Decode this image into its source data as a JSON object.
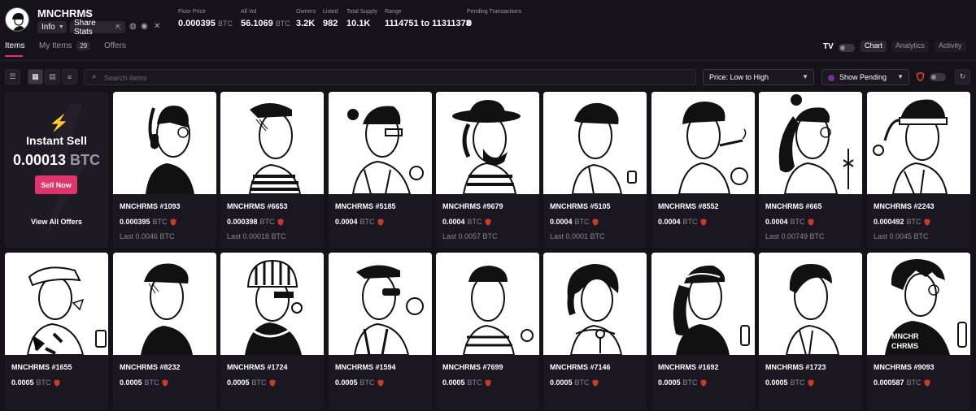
{
  "header": {
    "collection_name": "MNCHRMS",
    "info_label": "Info",
    "share_label": "Share Stats",
    "stats": [
      {
        "label": "Floor Price",
        "value": "0.000395",
        "unit": "BTC"
      },
      {
        "label": "All Vol",
        "value": "56.1069",
        "unit": "BTC"
      },
      {
        "label": "Owners",
        "value": "3.2K",
        "unit": ""
      },
      {
        "label": "Listed",
        "value": "982",
        "unit": ""
      },
      {
        "label": "Total Supply",
        "value": "10.1K",
        "unit": ""
      },
      {
        "label": "Range",
        "value": "1114751 to 11311378",
        "unit": ""
      },
      {
        "label": "Pending Transactions",
        "value": "0",
        "unit": ""
      }
    ]
  },
  "tabs": {
    "items": "Items",
    "my_items": "My Items",
    "my_items_count": "29",
    "offers": "Offers",
    "chart": "Chart",
    "analytics": "Analytics",
    "activity": "Activity"
  },
  "toolbar": {
    "search_placeholder": "Search items",
    "sort_value": "Price: Low to High",
    "pending_value": "Show Pending"
  },
  "instant_sell": {
    "title": "Instant Sell",
    "price": "0.00013",
    "unit": "BTC",
    "sell_button": "Sell Now",
    "view_offers": "View All Offers"
  },
  "cards": [
    {
      "name": "MNCHRMS #1093",
      "price": "0.000395",
      "unit": "BTC",
      "last": "Last 0.0046 BTC"
    },
    {
      "name": "MNCHRMS #6653",
      "price": "0.000398",
      "unit": "BTC",
      "last": "Last 0.00018 BTC"
    },
    {
      "name": "MNCHRMS #5185",
      "price": "0.0004",
      "unit": "BTC",
      "last": ""
    },
    {
      "name": "MNCHRMS #9679",
      "price": "0.0004",
      "unit": "BTC",
      "last": "Last 0.0057 BTC"
    },
    {
      "name": "MNCHRMS #5105",
      "price": "0.0004",
      "unit": "BTC",
      "last": "Last 0.0001 BTC"
    },
    {
      "name": "MNCHRMS #8552",
      "price": "0.0004",
      "unit": "BTC",
      "last": ""
    },
    {
      "name": "MNCHRMS #665",
      "price": "0.0004",
      "unit": "BTC",
      "last": "Last 0.00749 BTC"
    },
    {
      "name": "MNCHRMS #2243",
      "price": "0.000492",
      "unit": "BTC",
      "last": "Last 0.0045 BTC"
    },
    {
      "name": "MNCHRMS #1655",
      "price": "0.0005",
      "unit": "BTC",
      "last": ""
    },
    {
      "name": "MNCHRMS #8232",
      "price": "0.0005",
      "unit": "BTC",
      "last": ""
    },
    {
      "name": "MNCHRMS #1724",
      "price": "0.0005",
      "unit": "BTC",
      "last": ""
    },
    {
      "name": "MNCHRMS #1594",
      "price": "0.0005",
      "unit": "BTC",
      "last": ""
    },
    {
      "name": "MNCHRMS #7699",
      "price": "0.0005",
      "unit": "BTC",
      "last": ""
    },
    {
      "name": "MNCHRMS #7146",
      "price": "0.0005",
      "unit": "BTC",
      "last": ""
    },
    {
      "name": "MNCHRMS #1692",
      "price": "0.0005",
      "unit": "BTC",
      "last": ""
    },
    {
      "name": "MNCHRMS #1723",
      "price": "0.0005",
      "unit": "BTC",
      "last": ""
    },
    {
      "name": "MNCHRMS #9093",
      "price": "0.000587",
      "unit": "BTC",
      "last": ""
    }
  ],
  "colors": {
    "accent": "#e0346c",
    "background": "#15121a",
    "card": "#1a1720"
  },
  "icons": [
    "star-icon",
    "chevron-down-icon",
    "share-icon",
    "globe-icon",
    "discord-icon",
    "x-icon",
    "filter-icon",
    "grid-large-icon",
    "grid-small-icon",
    "list-icon",
    "search-icon",
    "refresh-icon",
    "bolt-icon",
    "shield-icon"
  ]
}
